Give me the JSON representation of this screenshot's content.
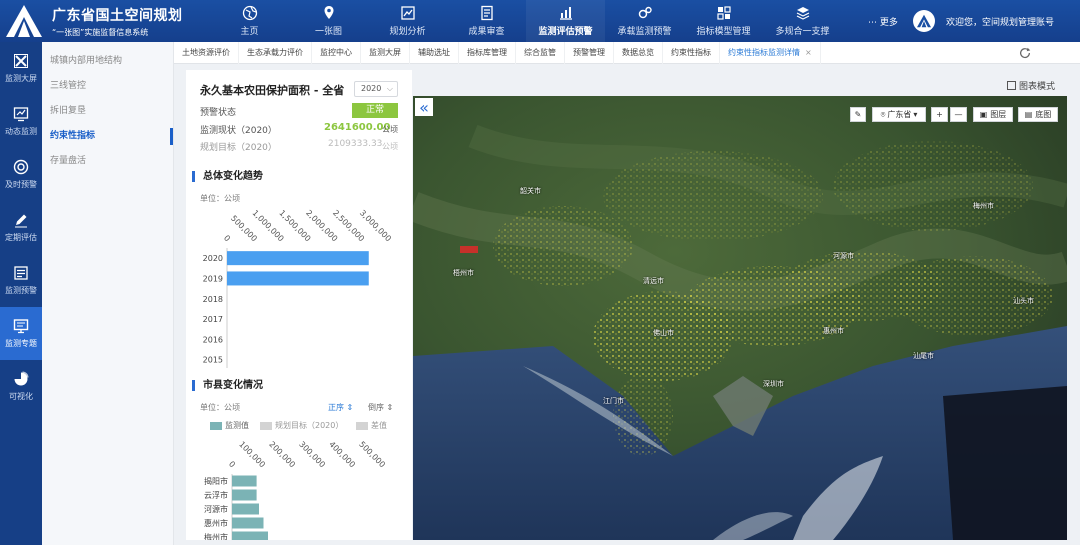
{
  "app": {
    "title": "广东省国土空间规划",
    "subtitle": "“一张图”实施监督信息系统"
  },
  "nav": [
    {
      "label": "主页",
      "icon": "globe-icon"
    },
    {
      "label": "一张图",
      "icon": "map-icon"
    },
    {
      "label": "规划分析",
      "icon": "analysis-icon"
    },
    {
      "label": "成果审查",
      "icon": "review-icon"
    },
    {
      "label": "监测评估预警",
      "icon": "monitor-chart-icon"
    },
    {
      "label": "承载监测预警",
      "icon": "gears-icon"
    },
    {
      "label": "指标模型管理",
      "icon": "model-icon"
    },
    {
      "label": "多规合一支撑",
      "icon": "layers-icon"
    }
  ],
  "header": {
    "more": "更多",
    "welcome": "欢迎您，空间规划管理账号"
  },
  "sidebar": [
    {
      "label": "监测大屏",
      "icon": "screen-icon"
    },
    {
      "label": "动态监测",
      "icon": "trend-icon"
    },
    {
      "label": "及时预警",
      "icon": "alert-icon"
    },
    {
      "label": "定期评估",
      "icon": "edit-icon"
    },
    {
      "label": "监测预警",
      "icon": "report-icon"
    },
    {
      "label": "监测专题",
      "icon": "monitor-icon"
    },
    {
      "label": "可视化",
      "icon": "pie-icon"
    }
  ],
  "submenu": [
    "城镇内部用地结构",
    "三线管控",
    "拆旧复垦",
    "约束性指标",
    "存量盘活"
  ],
  "tabs": [
    "土地资源评价",
    "生态承载力评价",
    "监控中心",
    "监测大屏",
    "辅助选址",
    "指标库管理",
    "综合监管",
    "预警管理",
    "数据总览",
    "约束性指标",
    "约束性指标监测详情"
  ],
  "tab_close": "×",
  "panel": {
    "title": "永久基本农田保护面积 - 全省",
    "year": "2020",
    "status_label": "预警状态",
    "status_value": "正常",
    "current_label": "监测现状（2020）",
    "current_value": "2641600.00",
    "target_label": "规划目标（2020）",
    "target_value": "2109333.33",
    "unit": "公顷",
    "trend_title": "总体变化趋势",
    "unit_label": "单位：公顷",
    "city_title": "市县变化情况",
    "sort_asc": "正序",
    "sort_desc": "倒序",
    "legend": [
      "监测值",
      "规划目标（2020）",
      "差值"
    ]
  },
  "map": {
    "view_mode": "图表模式",
    "region": "广东省",
    "layers": "图层",
    "basemap": "底图",
    "zoom_in": "+",
    "zoom_out": "—",
    "cities": [
      {
        "name": "韶关市"
      },
      {
        "name": "梅州市"
      },
      {
        "name": "河源市"
      },
      {
        "name": "汕头市"
      },
      {
        "name": "清远市"
      },
      {
        "name": "惠州市"
      },
      {
        "name": "佛山市"
      },
      {
        "name": "江门市"
      },
      {
        "name": "深圳市"
      },
      {
        "name": "汕尾市"
      },
      {
        "name": "梧州市"
      }
    ]
  },
  "chart_data": [
    {
      "type": "bar",
      "orientation": "horizontal",
      "categories": [
        "2020",
        "2019",
        "2018",
        "2017",
        "2016",
        "2015"
      ],
      "values": [
        2641600,
        2641600,
        0,
        0,
        0,
        0
      ],
      "xticks": [
        "0",
        "500,000",
        "1,000,000",
        "1,500,000",
        "2,000,000",
        "2,500,000",
        "3,000,000"
      ],
      "xlim": [
        0,
        3000000
      ],
      "color": "#4a9ff0"
    },
    {
      "type": "bar",
      "orientation": "horizontal",
      "categories": [
        "揭阳市",
        "云浮市",
        "河源市",
        "惠州市",
        "梅州市"
      ],
      "values": [
        82000,
        82000,
        90000,
        105000,
        120000
      ],
      "xticks": [
        "0",
        "100,000",
        "200,000",
        "300,000",
        "400,000",
        "500,000"
      ],
      "xlim": [
        0,
        500000
      ],
      "color": "#7bb3b5"
    }
  ]
}
